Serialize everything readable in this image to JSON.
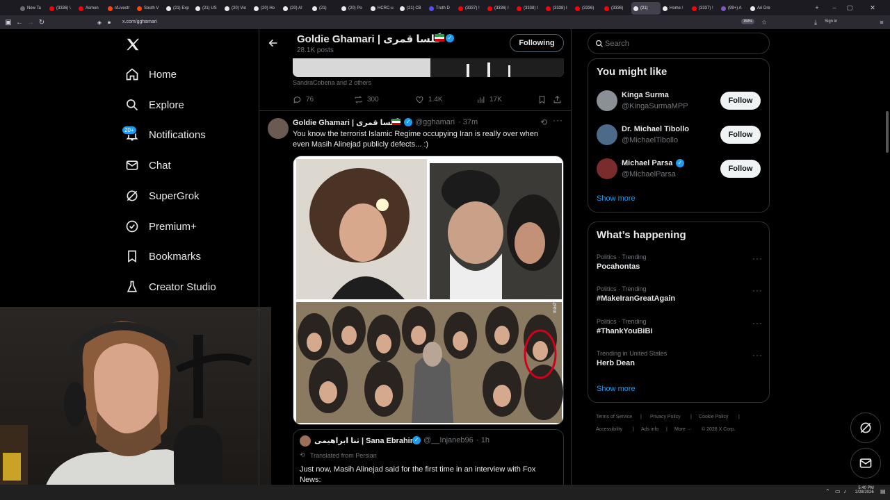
{
  "browser": {
    "tabs": [
      {
        "label": "New Ta",
        "color": "#6b6b75"
      },
      {
        "label": "(3336) \\",
        "color": "#ff0000"
      },
      {
        "label": "Asmon",
        "color": "#ff0000"
      },
      {
        "label": "r/Livestr",
        "color": "#ff4500"
      },
      {
        "label": "South V",
        "color": "#ff4500"
      },
      {
        "label": "(21) Exp",
        "color": "#e7e9ea"
      },
      {
        "label": "(21) US",
        "color": "#e7e9ea"
      },
      {
        "label": "(20) Vio",
        "color": "#e7e9ea"
      },
      {
        "label": "(20) Ho",
        "color": "#e7e9ea"
      },
      {
        "label": "(20) AI",
        "color": "#e7e9ea"
      },
      {
        "label": "(21)",
        "color": "#e7e9ea"
      },
      {
        "label": "(20) Po",
        "color": "#e7e9ea"
      },
      {
        "label": "HCRC-u",
        "color": "#e7e9ea"
      },
      {
        "label": "(21) CB",
        "color": "#e7e9ea"
      },
      {
        "label": "Truth D",
        "color": "#5b4cf0"
      },
      {
        "label": "(3337) !",
        "color": "#ff0000"
      },
      {
        "label": "(3336) I",
        "color": "#ff0000"
      },
      {
        "label": "(3338) I",
        "color": "#ff0000"
      },
      {
        "label": "(3338) I",
        "color": "#ff0000"
      },
      {
        "label": "(3336)",
        "color": "#ff0000"
      },
      {
        "label": "(3336)",
        "color": "#ff0000"
      },
      {
        "label": "(21)",
        "color": "#e7e9ea",
        "active": true
      },
      {
        "label": "Home /",
        "color": "#e7e9ea"
      },
      {
        "label": "(3337) !",
        "color": "#ff0000"
      },
      {
        "label": "(99+) A",
        "color": "#7e57c2"
      },
      {
        "label": "Ari Dre",
        "color": "#e7e9ea"
      }
    ],
    "url": "x.com/gghamari",
    "zoom": "150%",
    "sign_in": "Sign in"
  },
  "sidebar": {
    "items": [
      {
        "label": "Home"
      },
      {
        "label": "Explore"
      },
      {
        "label": "Notifications",
        "badge": "20+"
      },
      {
        "label": "Chat"
      },
      {
        "label": "SuperGrok"
      },
      {
        "label": "Premium+"
      },
      {
        "label": "Bookmarks"
      },
      {
        "label": "Creator Studio"
      }
    ]
  },
  "profile_header": {
    "name": "Goldie Ghamari | گلسا قمری",
    "posts": "28.1K posts",
    "following_label": "Following"
  },
  "prev_post": {
    "liked_by": "SandraCobena and 2 others",
    "replies": "76",
    "reposts": "300",
    "likes": "1.4K",
    "views": "17K"
  },
  "post": {
    "name": "Goldie Ghamari | گلسا قمری",
    "handle": "@gghamari",
    "time": "· 37m",
    "text_line1": "You know the terrorist Islamic Regime occupying Iran is really over when",
    "text_line2": "even Masih Alinejad publicly defects... :)",
    "watermark": "mash"
  },
  "quote": {
    "name": "ثنا ابراهیمی | Sana Ebrahimi",
    "handle": "@__Injaneb96",
    "time": "· 1h",
    "translated": "Translated from Persian",
    "text_line1": "Just now, Masih Alinejad said for the first time in an interview with Fox",
    "text_line2": "News:"
  },
  "search": {
    "placeholder": "Search"
  },
  "you_might_like": {
    "title": "You might like",
    "users": [
      {
        "name": "Kinga Surma",
        "handle": "@KingaSurmaMPP",
        "verified": false,
        "button": "Follow"
      },
      {
        "name": "Dr. Michael Tibollo",
        "handle": "@MichaelTibollo",
        "verified": false,
        "button": "Follow"
      },
      {
        "name": "Michael Parsa",
        "handle": "@MichaelParsa",
        "verified": true,
        "button": "Follow"
      }
    ],
    "show_more": "Show more"
  },
  "whats_happening": {
    "title": "What’s happening",
    "trends": [
      {
        "meta": "Politics · Trending",
        "name": "Pocahontas"
      },
      {
        "meta": "Politics · Trending",
        "name": "#MakeIranGreatAgain"
      },
      {
        "meta": "Politics · Trending",
        "name": "#ThankYouBiBi"
      },
      {
        "meta": "Trending in United States",
        "name": "Herb Dean"
      }
    ],
    "show_more": "Show more"
  },
  "footer": {
    "links": [
      "Terms of Service",
      "Privacy Policy",
      "Cookie Policy",
      "Accessibility",
      "Ads info",
      "More ···",
      "© 2026 X Corp."
    ]
  },
  "taskbar": {
    "time": "5:40 PM",
    "date": "2/28/2026"
  },
  "colors": {
    "accent": "#1d9bf0",
    "background": "#000000",
    "border": "#2f3336",
    "muted": "#71767b",
    "danger": "#e0245e"
  }
}
